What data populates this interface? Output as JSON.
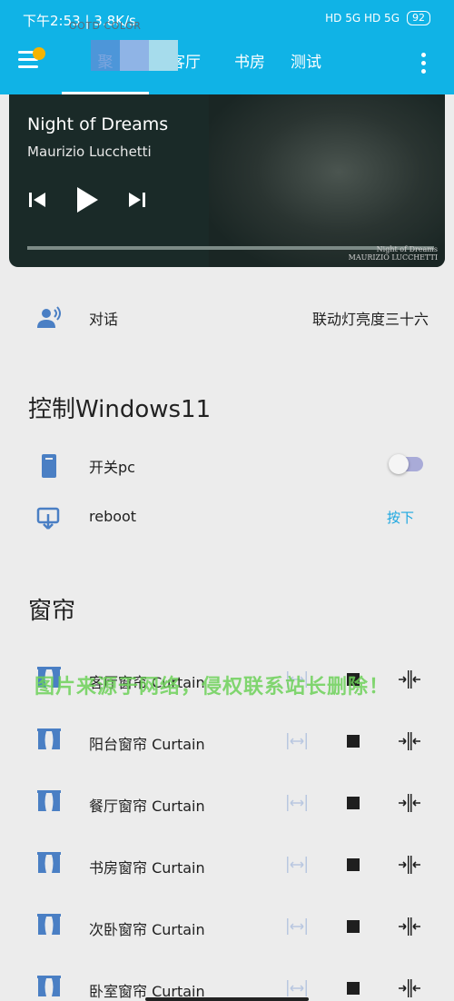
{
  "status_bar": {
    "time": "下午2:53 | 3.8K/s",
    "overlay": "OOTD COLOR",
    "signal": "HD 5G HD 5G",
    "battery": "92"
  },
  "app_bar": {
    "tabs": [
      "聚",
      "客厅",
      "书房",
      "测试"
    ]
  },
  "media": {
    "title": "Night of Dreams",
    "artist": "Maurizio Lucchetti",
    "progress": 0.0,
    "art_credit_line1": "Night of Dreams",
    "art_credit_line2": "MAURIZIO LUCCHETTI"
  },
  "dialog_row": {
    "label": "对话",
    "value": "联动灯亮度三十六"
  },
  "windows_section": {
    "title": "控制Windows11",
    "switch_label": "开关pc",
    "switch_on": false,
    "reboot_label": "reboot",
    "reboot_action": "按下"
  },
  "curtain_section": {
    "title": "窗帘",
    "items": [
      "客厅窗帘 Curtain",
      "阳台窗帘 Curtain",
      "餐厅窗帘 Curtain",
      "书房窗帘 Curtain",
      "次卧窗帘 Curtain",
      "卧室窗帘 Curtain"
    ]
  },
  "watermark": "图片来源于网络，侵权联系站长删除！",
  "colors": {
    "header": "#10b3e6",
    "accent": "#1da7e0",
    "icon": "#4a7fc4"
  }
}
